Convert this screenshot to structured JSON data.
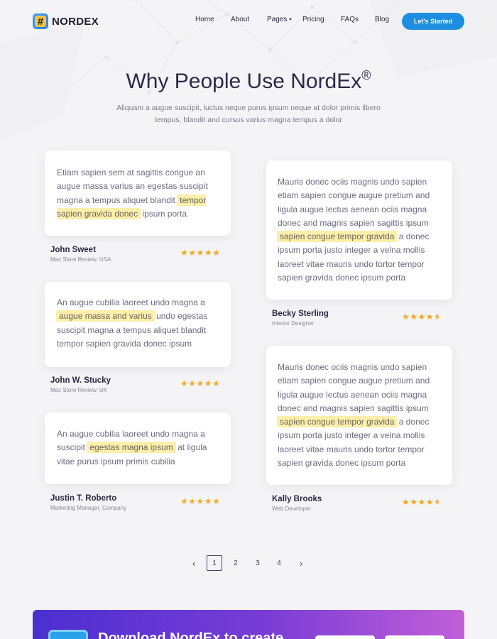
{
  "brand": {
    "name": "NORDEX",
    "icon_glyph": "#"
  },
  "nav": {
    "items": [
      "Home",
      "About",
      "Pages",
      "Pricing",
      "FAQs",
      "Blog"
    ],
    "cta": "Let's Started"
  },
  "hero": {
    "title": "Why People Use NordEx",
    "title_mark": "®",
    "subtitle": "Aliquam a augue suscipit, luctus neque purus ipsum neque at dolor primis libero tempus, blandit and cursus varius magna tempus a dolor"
  },
  "testimonials": [
    {
      "before": "Etiam sapien sem at sagittis congue an augue massa varius an egestas suscipit magna a tempus aliquet blandit ",
      "highlight": "tempor sapien gravida donec",
      "after": " ipsum porta",
      "name": "John Sweet",
      "role": "Mac Store Review, USA",
      "rating": 5
    },
    {
      "before": "Mauris donec ociis magnis undo sapien etiam sapien congue augue pretium and ligula augue lectus aenean ociis magna donec and magnis sapien sagittis ipsum ",
      "highlight": "sapien congue tempor gravida",
      "after": " a donec ipsum porta justo integer a velna mollis laoreet vitae mauris undo tortor tempor sapien gravida donec ipsum porta",
      "name": "Becky Sterling",
      "role": "Interior Designer",
      "rating": 4.5
    },
    {
      "before": "An augue cubilia laoreet undo magna a ",
      "highlight": "augue massa and varius",
      "after": " undo egestas suscipit magna a tempus aliquet blandit tempor sapien gravida donec ipsum",
      "name": "John W. Stucky",
      "role": "Mac Store Review, UK",
      "rating": 5
    },
    {
      "before": "Mauris donec ociis magnis undo sapien etiam sapien congue augue pretium and ligula augue lectus aenean ociis magna donec and magnis sapien sagittis ipsum ",
      "highlight": "sapien congue tempor gravida",
      "after": " a donec ipsum porta justo integer a velna mollis laoreet vitae mauris undo tortor tempor sapien gravida donec ipsum porta",
      "name": "Kally Brooks",
      "role": "Web Developer",
      "rating": 4.5
    },
    {
      "before": "An augue cubilia laoreet undo magna a suscipit ",
      "highlight": "egestas magna ipsum",
      "after": " at ligula vitae purus ipsum primis cubilia",
      "name": "Justin T. Roberto",
      "role": "Marketing Manager, Company",
      "rating": 5
    }
  ],
  "pagination": {
    "pages": [
      "1",
      "2",
      "3",
      "4"
    ],
    "current": "1",
    "prev_icon": "chevron-left-icon",
    "next_icon": "chevron-right-icon"
  },
  "banner": {
    "text": "Download NordEx to create"
  },
  "colors": {
    "accent": "#1d8ee0",
    "highlight": "#fcefaa",
    "star": "#f4a923",
    "banner_start": "#4b2fd0",
    "banner_end": "#c25fd8"
  }
}
